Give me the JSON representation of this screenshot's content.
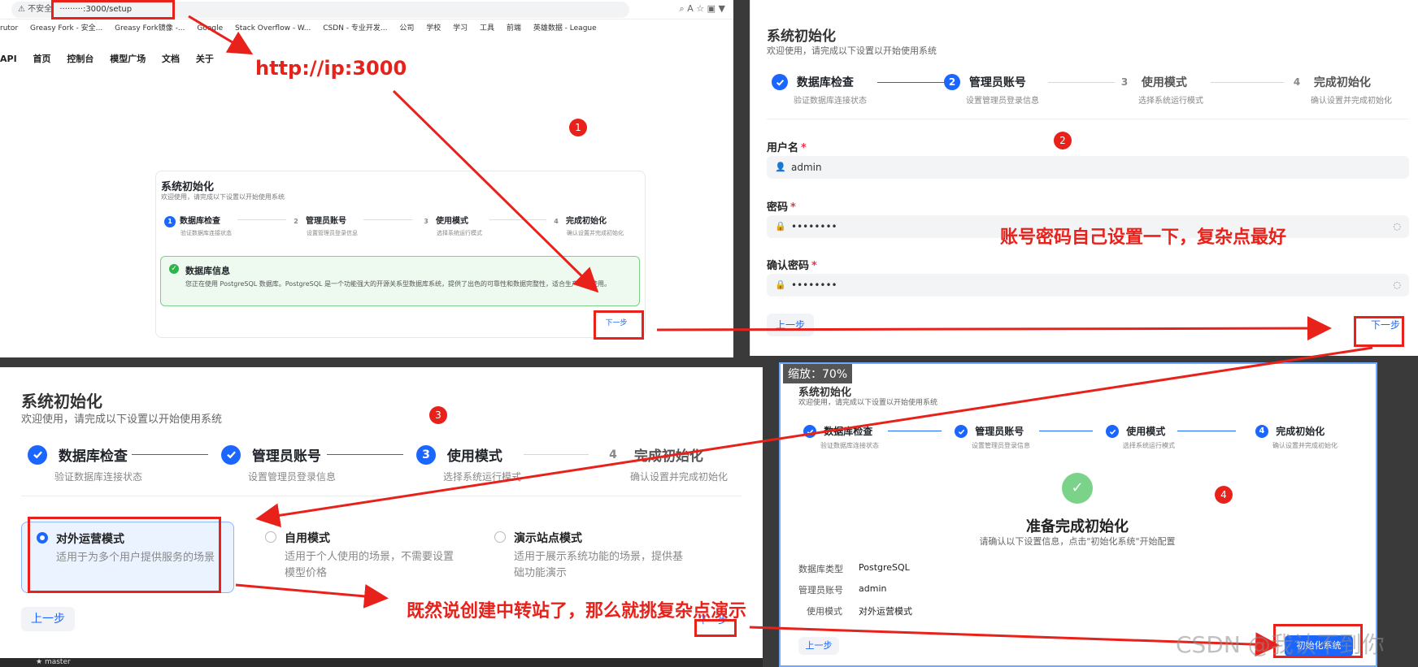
{
  "browser": {
    "insecure_label": "不安全",
    "url": "·········:3000/setup",
    "bookmarks": [
      "rutor",
      "Greasy Fork - 安全...",
      "Greasy Fork镜像 -...",
      "Google",
      "Stack Overflow - W...",
      "CSDN - 专业开发...",
      "公司",
      "学校",
      "学习",
      "工具",
      "前端",
      "英雄数据 - League"
    ],
    "nav": [
      "API",
      "首页",
      "控制台",
      "模型广场",
      "文档",
      "关于"
    ]
  },
  "setup": {
    "title": "系统初始化",
    "subtitle": "欢迎使用，请完成以下设置以开始使用系统",
    "steps": [
      {
        "label": "数据库检查",
        "desc": "验证数据库连接状态"
      },
      {
        "label": "管理员账号",
        "desc": "设置管理员登录信息"
      },
      {
        "label": "使用模式",
        "desc": "选择系统运行模式"
      },
      {
        "label": "完成初始化",
        "desc": "确认设置并完成初始化"
      }
    ],
    "db_info_title": "数据库信息",
    "db_info_text": "您正在使用 PostgreSQL 数据库。PostgreSQL 是一个功能强大的开源关系型数据库系统，提供了出色的可靠性和数据完整性，适合生产环境使用。",
    "prev": "上一步",
    "next": "下一步"
  },
  "account": {
    "username_label": "用户名",
    "username_value": "admin",
    "password_label": "密码",
    "password_value": "••••••••",
    "confirm_label": "确认密码",
    "confirm_value": "••••••••",
    "required_mark": "*"
  },
  "modes": [
    {
      "title": "对外运营模式",
      "desc": "适用于为多个用户提供服务的场景",
      "selected": true
    },
    {
      "title": "自用模式",
      "desc": "适用于个人使用的场景，不需要设置模型价格",
      "selected": false
    },
    {
      "title": "演示站点模式",
      "desc": "适用于展示系统功能的场景，提供基础功能演示",
      "selected": false
    }
  ],
  "finish": {
    "zoom": "缩放：70%",
    "ready_title": "准备完成初始化",
    "ready_sub": "请确认以下设置信息，点击\"初始化系统\"开始配置",
    "rows": [
      {
        "k": "数据库类型",
        "v": "PostgreSQL"
      },
      {
        "k": "管理员账号",
        "v": "admin"
      },
      {
        "k": "使用模式",
        "v": "对外运营模式"
      }
    ],
    "init_button": "初始化系统"
  },
  "annotations": {
    "url_hint": "http://ip:3000",
    "badges": [
      "1",
      "2",
      "3",
      "4"
    ],
    "password_hint": "账号密码自己设置一下，复杂点最好",
    "mode_hint": "既然说创建中转站了，那么就挑复杂点演示",
    "watermark": "CSDN @我认不到你",
    "accent": "#e8221b",
    "primary": "#1a66ff"
  },
  "misc": {
    "branch": "master"
  }
}
